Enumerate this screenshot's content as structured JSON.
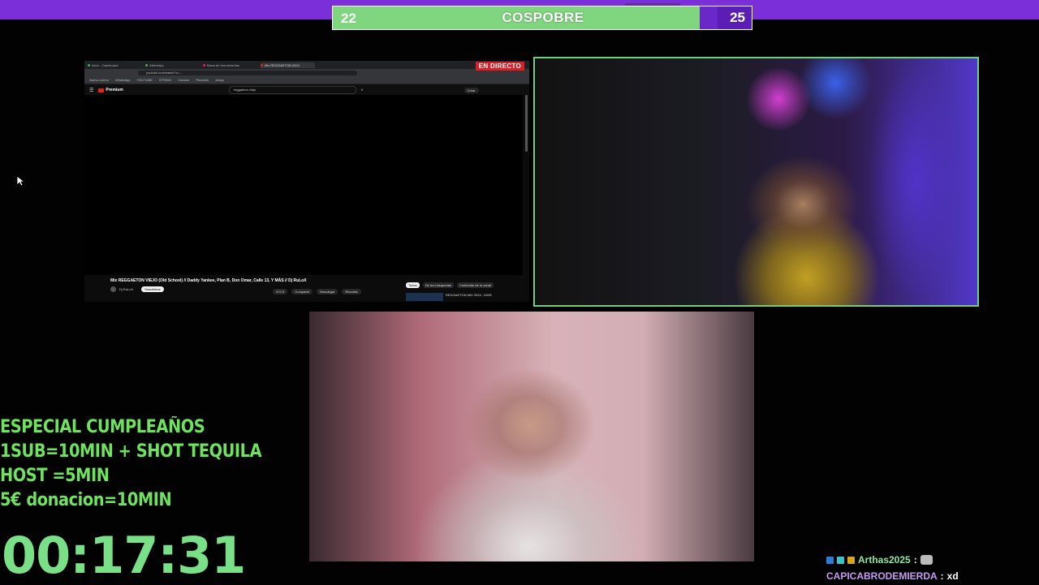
{
  "score": {
    "left": "22",
    "title": "COSPOBRE",
    "right": "25"
  },
  "browser": {
    "tabs": [
      "Inicio - Dashboard",
      "Afterships",
      "Barra de herramientas",
      "Mix REGGAETON 2024"
    ],
    "live_badge": "EN DIRECTO",
    "address": "youtube.com/watch?v=...",
    "bookmarks": [
      "Nuevo correo",
      "WhatsApp",
      "YOUTUBE",
      "STRING",
      "Creador",
      "Pecados",
      "Juego"
    ],
    "yt_logo": "Premium",
    "search_value": "reggaeton viejo",
    "create_label": "Crear",
    "video_title": "Mix REGGAETON VIEJO (Old School) // Daddy Yankee, Plan B, Don Omar, Calle 13, Y MÁS // Dj RuLoX",
    "channel": "Dj RuLoX",
    "subscribe_label": "Suscribirse",
    "actions": [
      "472 K",
      "Compartir",
      "Descargar",
      "Recortar"
    ],
    "chips": [
      "Todos",
      "De tus búsquedas",
      "Contenido de tu canal"
    ],
    "side_video": "REGGAETON MIX 2024 - MIXE"
  },
  "overlay": {
    "lines": [
      "ESPECIAL CUMPLEAÑOS",
      "1SUB=10MIN + SHOT TEQUILA",
      "HOST =5MIN",
      "5€ donacion=10MIN"
    ],
    "timer": "00:17:31"
  },
  "chat": [
    {
      "user": "Arthas2025",
      "sep": ":",
      "msg": ""
    },
    {
      "user": "CAPICABRODEMIERDA",
      "sep": ":",
      "msg": "xd"
    }
  ],
  "colors": {
    "topbar": "#7a2fd8",
    "score_green": "#7fd67f",
    "overlay_green": "#6ee35d",
    "live_red": "#d91f26"
  }
}
